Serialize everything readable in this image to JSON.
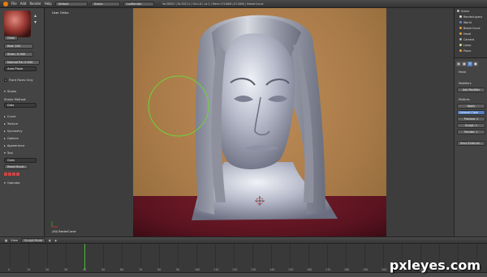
{
  "topbar": {
    "menus": [
      "File",
      "Add",
      "Render",
      "Help"
    ],
    "layout": "Default",
    "scene": "Scene",
    "engine": "LuxRender",
    "stats": "Ve:28503 | Fa:28114 | Ob:1-8 | La:1 | Mem:173.68M (23.50M) | BezierCurve"
  },
  "left_panel": {
    "brush_name": "Grab",
    "radius": "Rad: 100",
    "strength": "Stren: 0.300",
    "normal_radius": "Normal Ra: 0.500",
    "area_plane": "Area Plane",
    "front_faces": "Front Faces Only",
    "stroke": "Stroke",
    "stroke_method_label": "Stroke Method:",
    "stroke_method": "Dots",
    "sections": [
      "Curve",
      "Texture",
      "Symmetry",
      "Options",
      "Appearance",
      "Tool"
    ],
    "tool_brush": "Grab",
    "reset_brush": "Reset Brush",
    "operator": "Operator"
  },
  "viewport": {
    "view_label": "User Ortho",
    "object_label": "(40) BezierCurve"
  },
  "outliner": {
    "items": [
      {
        "label": "Scene",
        "color": "#bbbbbb"
      },
      {
        "label": "RenderLayers",
        "color": "#dddddd"
      },
      {
        "label": "World",
        "color": "#6688cc"
      },
      {
        "label": "BezierCurve",
        "color": "#e89a3a"
      },
      {
        "label": "Head",
        "color": "#e8a03a"
      },
      {
        "label": "Camera",
        "color": "#aaaaaa"
      },
      {
        "label": "Lamp",
        "color": "#dddd88"
      },
      {
        "label": "Plane",
        "color": "#e8a03a"
      }
    ]
  },
  "properties": {
    "object": "Head",
    "modifier_header": "Modifiers",
    "add_modifier": "Add Modifier",
    "modifier_name": "Multires",
    "apply": "Apply",
    "subdivision_type": "Catmull-Clark",
    "preview": "Preview: 1",
    "sculpt": "Sculpt: 1",
    "render": "Render: 1",
    "save_external": "Save External..."
  },
  "timeline": {
    "view": "View",
    "mode": "Sculpt Mode",
    "current_frame": 40,
    "ticks": [
      "0",
      "10",
      "20",
      "30",
      "40",
      "50",
      "60",
      "70",
      "80",
      "90",
      "100",
      "110",
      "120",
      "130",
      "140",
      "150",
      "160",
      "170",
      "180",
      "190",
      "200",
      "210",
      "220",
      "230",
      "240",
      "250"
    ]
  },
  "watermark": "pxleyes.com",
  "colors": {
    "accent": "#5680c2",
    "brush_circle": "#6fd23a",
    "timeline_cursor": "#4cbb3a"
  }
}
